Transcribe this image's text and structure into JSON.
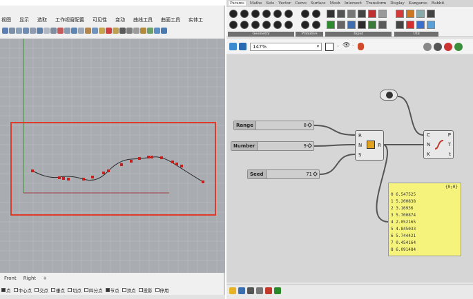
{
  "rhino": {
    "menubar": [
      "视图",
      "显示",
      "选取",
      "工作视窗配置",
      "可见性",
      "变动",
      "曲线工具",
      "曲面工具",
      "实体工"
    ],
    "viewport_tabs": [
      "Front",
      "Right",
      "+"
    ],
    "osnaps": [
      {
        "label": "点",
        "checked": true
      },
      {
        "label": "中心点",
        "checked": false
      },
      {
        "label": "交点",
        "checked": false
      },
      {
        "label": "垂点",
        "checked": false
      },
      {
        "label": "切点",
        "checked": false
      },
      {
        "label": "四分点",
        "checked": false
      },
      {
        "label": "节点",
        "checked": true
      },
      {
        "label": "顶点",
        "checked": false
      },
      {
        "label": "投影",
        "checked": false
      },
      {
        "label": "停用",
        "checked": false
      }
    ]
  },
  "gh": {
    "tabs": [
      "Params",
      "Maths",
      "Sets",
      "Vector",
      "Curve",
      "Surface",
      "Mesh",
      "Intersect",
      "Transform",
      "Display",
      "Kangaroo",
      "Rabbit"
    ],
    "ribbon_groups": [
      "Geometry",
      "Primitive",
      "Input",
      "Util"
    ],
    "zoom": "147%",
    "sliders": [
      {
        "label": "Range",
        "value": "8"
      },
      {
        "label": "Number",
        "value": "9"
      },
      {
        "label": "Seed",
        "value": "71"
      }
    ],
    "random": {
      "inputs": [
        "R",
        "N",
        "S"
      ],
      "output": "R"
    },
    "graph": {
      "inputs": [
        "C",
        "N",
        "K"
      ],
      "outputs": [
        "P",
        "T",
        "t"
      ]
    },
    "panel": {
      "header": "{0;0}",
      "rows": [
        "0 6.547525",
        "1 5.200838",
        "2 3.16936",
        "3 5.700874",
        "4 2.052165",
        "5 4.845033",
        "6 5.744421",
        "7 0.454164",
        "8 6.091484"
      ]
    }
  }
}
